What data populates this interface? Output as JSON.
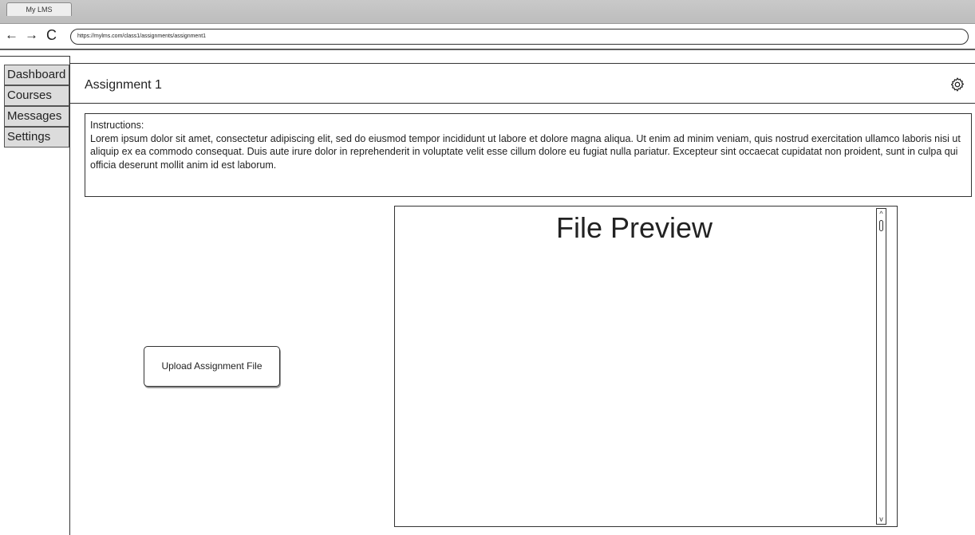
{
  "browser": {
    "tab_title": "My LMS",
    "back": "←",
    "forward": "→",
    "reload": "C",
    "url": "https://mylms.com/class1/assignments/assignment1"
  },
  "sidebar": {
    "items": [
      {
        "label": "Dashboard"
      },
      {
        "label": "Courses"
      },
      {
        "label": "Messages"
      },
      {
        "label": "Settings"
      }
    ]
  },
  "header": {
    "title": "Assignment 1",
    "settings_icon": "gear-icon"
  },
  "instructions": {
    "heading": "Instructions:",
    "body": "Lorem ipsum dolor sit amet, consectetur adipiscing elit, sed do eiusmod tempor incididunt ut labore et dolore magna aliqua. Ut enim ad minim veniam, quis nostrud exercitation ullamco laboris nisi ut aliquip ex ea commodo consequat. Duis aute irure dolor in reprehenderit in voluptate velit esse cillum dolore eu fugiat nulla pariatur. Excepteur sint occaecat cupidatat non proident, sunt in culpa qui officia deserunt mollit anim id est laborum."
  },
  "upload": {
    "label": "Upload Assignment File"
  },
  "preview": {
    "title": "File Preview",
    "scroll_up": "^",
    "scroll_down": "v"
  }
}
